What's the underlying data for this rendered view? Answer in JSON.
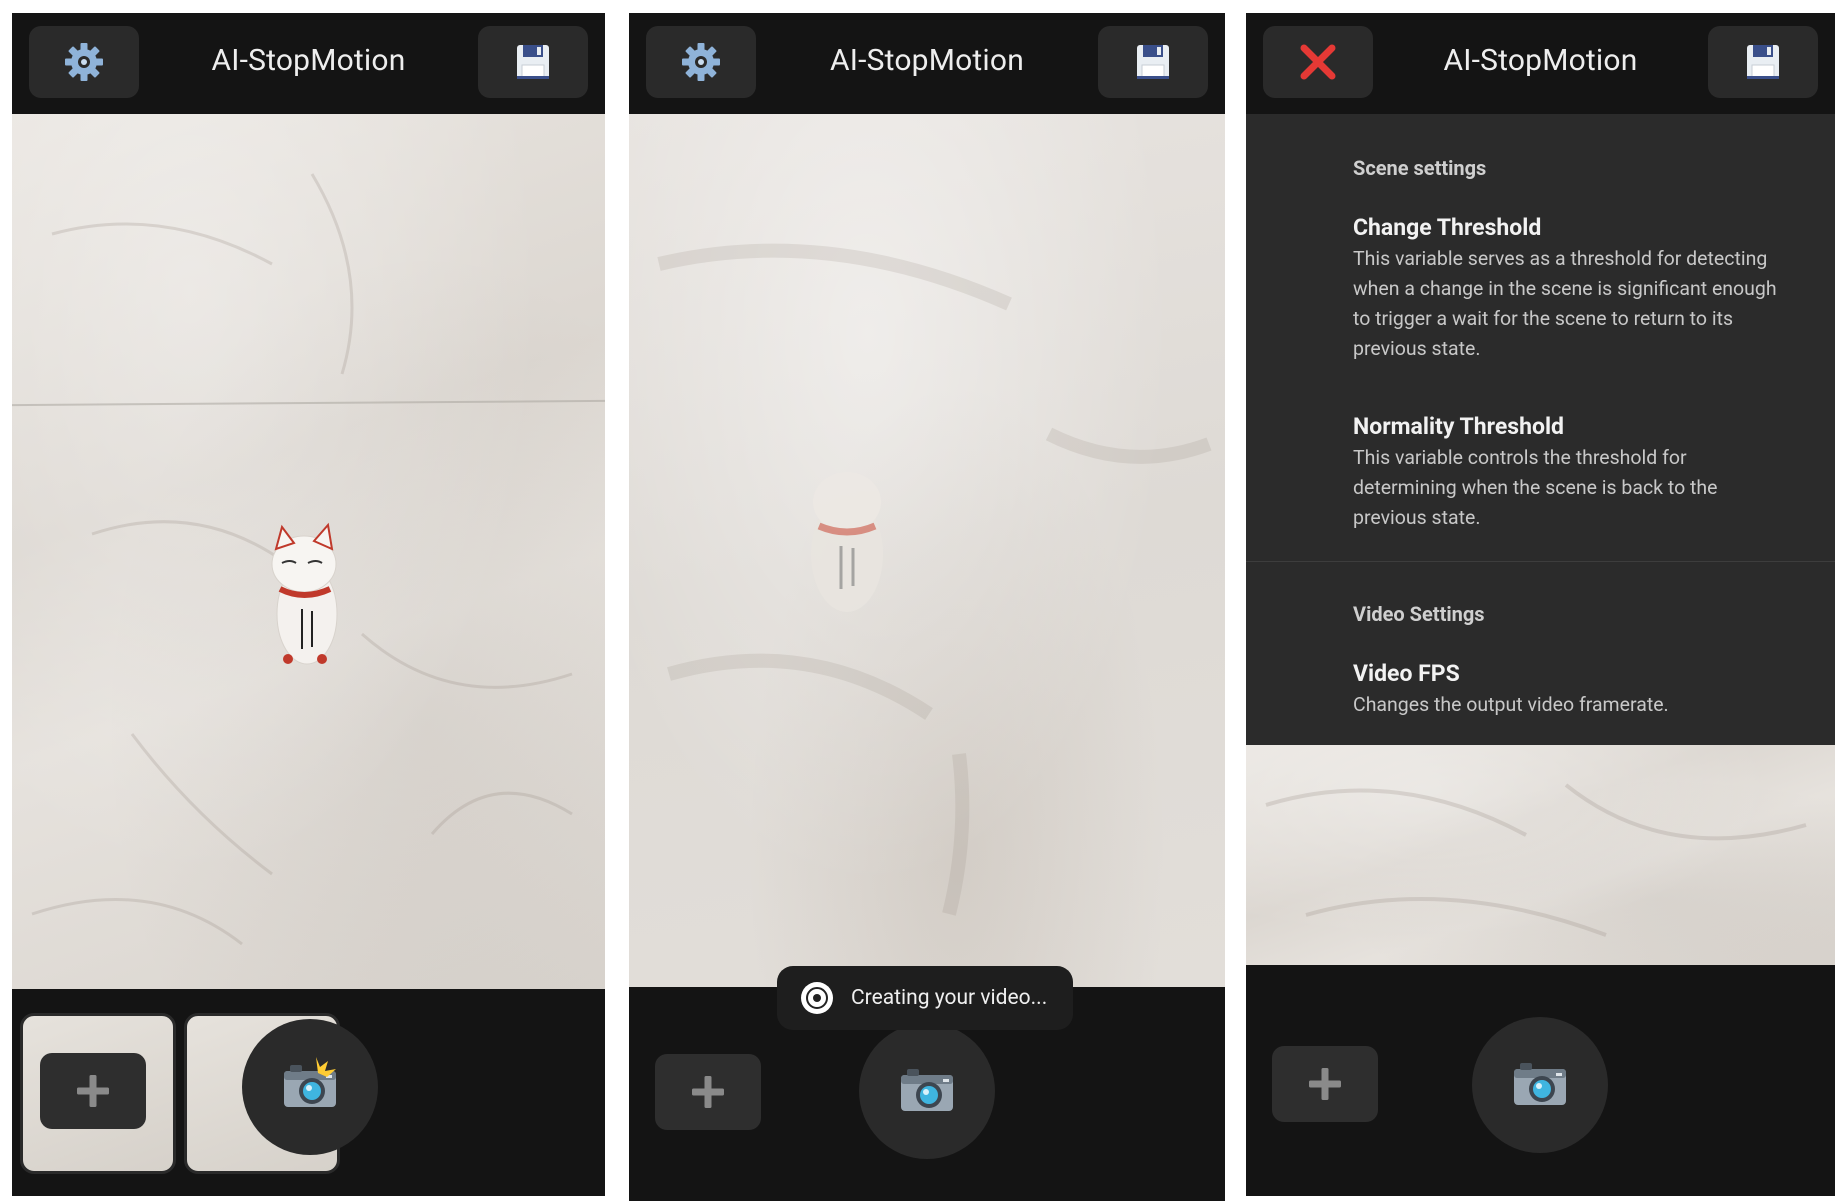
{
  "app": {
    "title": "AI-StopMotion"
  },
  "toolbar": {
    "settings_icon": "gear-icon",
    "save_icon": "floppy-disk-icon",
    "close_icon": "red-x-icon"
  },
  "bottom": {
    "add_icon": "plus-icon",
    "shutter_icon": "camera-icon",
    "shutter_flash_icon": "camera-with-flash-icon"
  },
  "toast": {
    "text": "Creating your video..."
  },
  "settings": {
    "scene_section": "Scene settings",
    "change_threshold_title": "Change Threshold",
    "change_threshold_desc": "This variable serves as a threshold for detecting when a change in the scene is significant enough to trigger a wait for the scene to return to its previous state.",
    "normality_threshold_title": "Normality Threshold",
    "normality_threshold_desc": "This variable controls the threshold for determining when the scene is back to the previous state.",
    "video_section": "Video Settings",
    "video_fps_title": "Video FPS",
    "video_fps_desc": "Changes the output video framerate."
  },
  "colors": {
    "bar_bg": "#141414",
    "button_bg": "#2a2a2a",
    "settings_bg": "#2b2b2b",
    "gear_blue": "#8fb3d9",
    "close_red": "#e53935"
  }
}
